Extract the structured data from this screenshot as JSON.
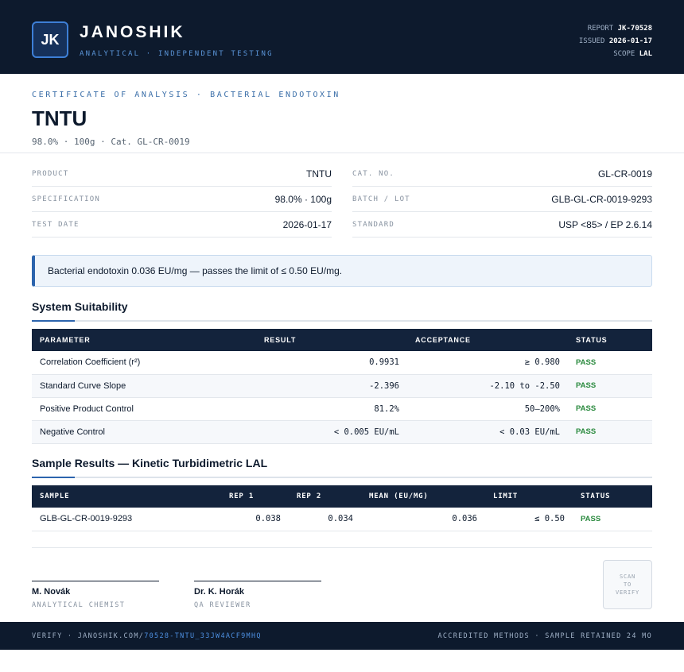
{
  "header": {
    "logo_initials": "JK",
    "brand": "JANOSHIK",
    "tagline": "ANALYTICAL · INDEPENDENT TESTING",
    "report_label": "REPORT",
    "report_value": "JK-70528",
    "issued_label": "ISSUED",
    "issued_value": "2026-01-17",
    "scope_label": "SCOPE",
    "scope_value": "LAL"
  },
  "title_block": {
    "certificate_label": "CERTIFICATE OF ANALYSIS · BACTERIAL ENDOTOXIN",
    "title": "TNTU",
    "subtitle": "98.0% · 100g  ·  Cat. GL-CR-0019"
  },
  "info": {
    "left": [
      {
        "label": "PRODUCT",
        "value": "TNTU"
      },
      {
        "label": "SPECIFICATION",
        "value": "98.0% · 100g"
      },
      {
        "label": "TEST DATE",
        "value": "2026-01-17"
      }
    ],
    "right": [
      {
        "label": "CAT. NO.",
        "value": "GL-CR-0019"
      },
      {
        "label": "BATCH / LOT",
        "value": "GLB-GL-CR-0019-9293"
      },
      {
        "label": "STANDARD",
        "value": "USP <85> / EP 2.6.14"
      }
    ]
  },
  "notice": "Bacterial endotoxin 0.036 EU/mg — passes the limit of ≤ 0.50 EU/mg.",
  "suitability": {
    "title": "System Suitability",
    "headers": [
      "PARAMETER",
      "RESULT",
      "ACCEPTANCE",
      "STATUS"
    ],
    "rows": [
      {
        "parameter": "Correlation Coefficient (r²)",
        "result": "0.9931",
        "acceptance": "≥ 0.980",
        "status": "PASS"
      },
      {
        "parameter": "Standard Curve Slope",
        "result": "-2.396",
        "acceptance": "-2.10 to -2.50",
        "status": "PASS"
      },
      {
        "parameter": "Positive Product Control",
        "result": "81.2%",
        "acceptance": "50–200%",
        "status": "PASS"
      },
      {
        "parameter": "Negative Control",
        "result": "< 0.005 EU/mL",
        "acceptance": "< 0.03 EU/mL",
        "status": "PASS"
      }
    ]
  },
  "samples": {
    "title": "Sample Results — Kinetic Turbidimetric LAL",
    "headers": [
      "SAMPLE",
      "REP 1",
      "REP 2",
      "MEAN (EU/MG)",
      "LIMIT",
      "STATUS"
    ],
    "rows": [
      {
        "sample": "GLB-GL-CR-0019-9293",
        "rep1": "0.038",
        "rep2": "0.034",
        "mean": "0.036",
        "limit": "≤ 0.50",
        "status": "PASS"
      }
    ]
  },
  "signatures": [
    {
      "name": "M. Novák",
      "role": "ANALYTICAL CHEMIST"
    },
    {
      "name": "Dr. K. Horák",
      "role": "QA REVIEWER"
    }
  ],
  "qr": {
    "line1": "SCAN",
    "line2": "TO",
    "line3": "VERIFY"
  },
  "footer": {
    "verify_prefix": "VERIFY · JANOSHIK.COM/",
    "verify_link": "70528-TNTU_33JW4ACF9MHQ",
    "right": "ACCREDITED METHODS · SAMPLE RETAINED 24 MO"
  }
}
